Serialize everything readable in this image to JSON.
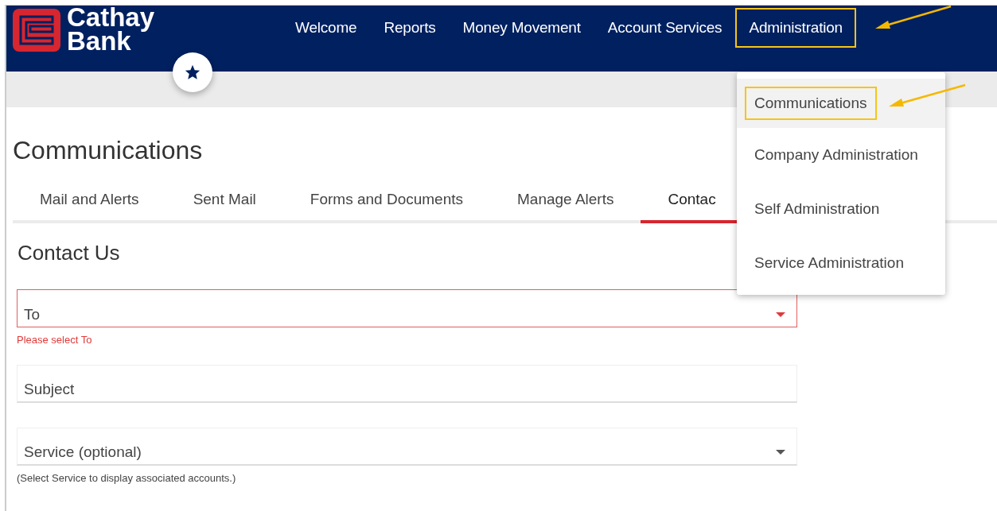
{
  "logo": {
    "line_1": "Cathay",
    "line_2": "Bank"
  },
  "nav": [
    {
      "label": "Welcome",
      "highlighted": false
    },
    {
      "label": "Reports",
      "highlighted": false
    },
    {
      "label": "Money Movement",
      "highlighted": false
    },
    {
      "label": "Account Services",
      "highlighted": false
    },
    {
      "label": "Administration",
      "highlighted": true
    }
  ],
  "page_title": "Communications",
  "tabs": [
    {
      "label": "Mail and Alerts",
      "selected": false
    },
    {
      "label": "Sent Mail",
      "selected": false
    },
    {
      "label": "Forms and Documents",
      "selected": false
    },
    {
      "label": "Manage Alerts",
      "selected": false
    },
    {
      "label": "Contac",
      "selected": true
    }
  ],
  "section_title": "Contact Us",
  "fields": [
    {
      "kind": "select",
      "label": "To",
      "error": true,
      "message": "Please select To"
    },
    {
      "kind": "text",
      "label": "Subject",
      "error": false
    },
    {
      "kind": "select",
      "label": "Service (optional)",
      "error": false,
      "message": "(Select Service to display associated accounts.)"
    }
  ],
  "dropdown_menu": [
    {
      "label": "Communications",
      "selected": true,
      "highlighted": true
    },
    {
      "label": "Company Administration",
      "selected": false,
      "highlighted": false
    },
    {
      "label": "Self Administration",
      "selected": false,
      "highlighted": false
    },
    {
      "label": "Service Administration",
      "selected": false,
      "highlighted": false
    }
  ]
}
